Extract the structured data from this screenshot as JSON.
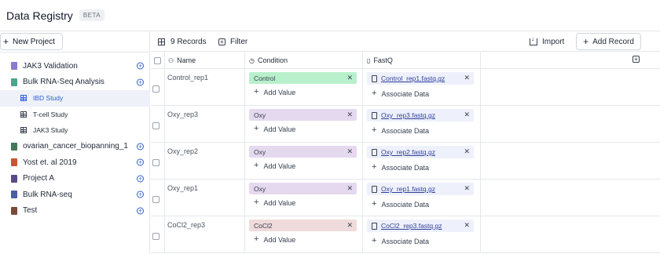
{
  "app": {
    "title": "Data Registry",
    "badge": "BETA"
  },
  "sidebar": {
    "new_project_label": "New Project",
    "items": [
      {
        "label": "JAK3 Validation",
        "level": 0,
        "color": "#8b7ad6"
      },
      {
        "label": "Bulk RNA-Seq Analysis",
        "level": 0,
        "color": "#4aa58b"
      },
      {
        "label": "IBD Study",
        "level": 1,
        "selected": true
      },
      {
        "label": "T-cell Study",
        "level": 1
      },
      {
        "label": "JAK3 Study",
        "level": 1
      },
      {
        "label": "ovarian_cancer_biopanning_1",
        "level": 0,
        "color": "#3f7a5a"
      },
      {
        "label": "Yost et. al 2019",
        "level": 0,
        "color": "#c8562e"
      },
      {
        "label": "Project A",
        "level": 0,
        "color": "#5b4a8a"
      },
      {
        "label": "Bulk RNA-seq",
        "level": 0,
        "color": "#4a5fa6"
      },
      {
        "label": "Test",
        "level": 0,
        "color": "#7a4a3a"
      }
    ]
  },
  "toolbar": {
    "records_label": "9 Records",
    "filter_label": "Filter",
    "import_label": "Import",
    "add_record_label": "Add Record"
  },
  "grid": {
    "columns": {
      "name": "Name",
      "condition": "Condition",
      "fastq": "FastQ"
    },
    "add_value_label": "Add Value",
    "associate_label": "Associate Data",
    "condition_colors": {
      "Control": "#b9f0cc",
      "Oxy": "#e4d9ee",
      "CoCl2": "#efdbdb"
    },
    "rows": [
      {
        "name": "Control_rep1",
        "condition": "Control",
        "file": "Control_rep1.fastq.gz"
      },
      {
        "name": "Oxy_rep3",
        "condition": "Oxy",
        "file": "Oxy_rep3.fastq.gz"
      },
      {
        "name": "Oxy_rep2",
        "condition": "Oxy",
        "file": "Oxy_rep2.fastq.gz"
      },
      {
        "name": "Oxy_rep1",
        "condition": "Oxy",
        "file": "Oxy_rep1.fastq.gz"
      },
      {
        "name": "CoCl2_rep3",
        "condition": "CoCl2",
        "file": "CoCl2_rep3.fastq.gz"
      }
    ]
  }
}
